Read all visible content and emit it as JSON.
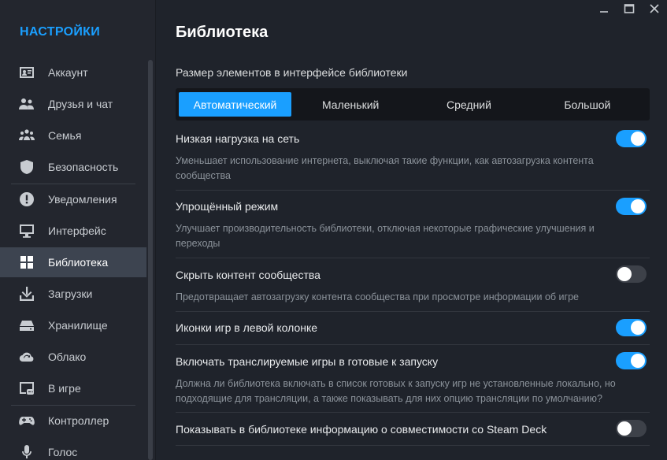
{
  "sidebar": {
    "title": "НАСТРОЙКИ",
    "items": [
      {
        "label": "Аккаунт",
        "icon": "account-card-icon"
      },
      {
        "label": "Друзья и чат",
        "icon": "friends-icon"
      },
      {
        "label": "Семья",
        "icon": "family-icon"
      },
      {
        "label": "Безопасность",
        "icon": "shield-icon"
      },
      {
        "label": "Уведомления",
        "icon": "alert-icon"
      },
      {
        "label": "Интерфейс",
        "icon": "monitor-icon"
      },
      {
        "label": "Библиотека",
        "icon": "grid-icon",
        "active": true
      },
      {
        "label": "Загрузки",
        "icon": "download-icon"
      },
      {
        "label": "Хранилище",
        "icon": "storage-icon"
      },
      {
        "label": "Облако",
        "icon": "cloud-sync-icon"
      },
      {
        "label": "В игре",
        "icon": "ingame-icon"
      },
      {
        "label": "Контроллер",
        "icon": "gamepad-icon"
      },
      {
        "label": "Голос",
        "icon": "microphone-icon"
      }
    ]
  },
  "main": {
    "title": "Библиотека",
    "size_section_label": "Размер элементов в интерфейсе библиотеки",
    "size_options": [
      "Автоматический",
      "Маленький",
      "Средний",
      "Большой"
    ],
    "size_selected": "Автоматический",
    "settings": [
      {
        "title": "Низкая нагрузка на сеть",
        "desc": "Уменьшает использование интернета, выключая такие функции, как автозагрузка контента сообщества",
        "on": true
      },
      {
        "title": "Упрощённый режим",
        "desc": "Улучшает производительность библиотеки, отключая некоторые графические улучшения и переходы",
        "on": true
      },
      {
        "title": "Скрыть контент сообщества",
        "desc": "Предотвращает автозагрузку контента сообщества при просмотре информации об игре",
        "on": false
      },
      {
        "title": "Иконки игр в левой колонке",
        "desc": "",
        "on": true
      },
      {
        "title": "Включать транслируемые игры в готовые к запуску",
        "desc": "Должна ли библиотека включать в список готовых к запуску игр не установленные локально, но подходящие для трансляции, а также показывать для них опцию трансляции по умолчанию?",
        "on": true
      },
      {
        "title": "Показывать в библиотеке информацию о совместимости со Steam Deck",
        "desc": "",
        "on": false
      }
    ]
  },
  "colors": {
    "accent": "#1a9fff",
    "background": "#1f232b",
    "sidebar": "#23262e",
    "toggle_off": "#3d4149"
  }
}
